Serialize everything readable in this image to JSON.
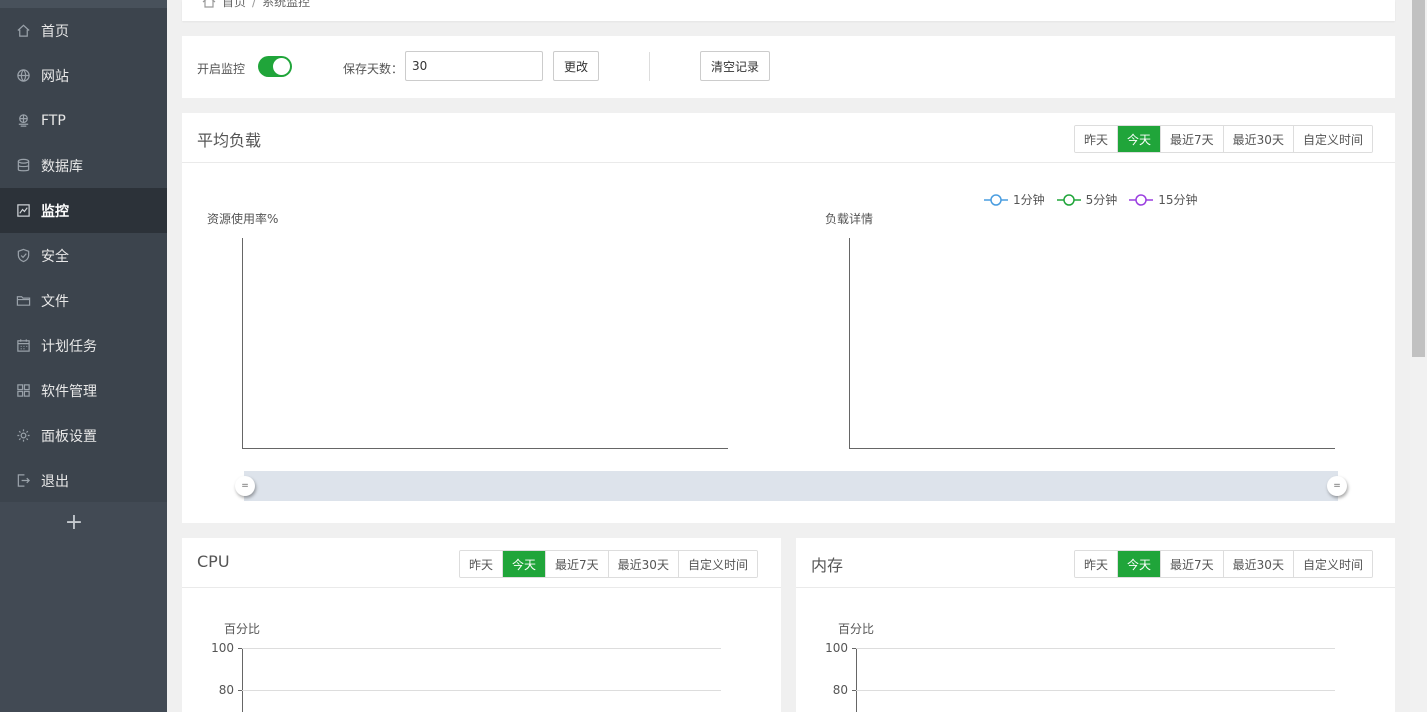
{
  "sidebar": {
    "items": [
      {
        "label": "首页",
        "icon": "home-icon",
        "active": false
      },
      {
        "label": "网站",
        "icon": "globe-icon",
        "active": false
      },
      {
        "label": "FTP",
        "icon": "ftp-icon",
        "active": false
      },
      {
        "label": "数据库",
        "icon": "database-icon",
        "active": false
      },
      {
        "label": "监控",
        "icon": "monitor-chart-icon",
        "active": true
      },
      {
        "label": "安全",
        "icon": "shield-icon",
        "active": false
      },
      {
        "label": "文件",
        "icon": "folder-icon",
        "active": false
      },
      {
        "label": "计划任务",
        "icon": "calendar-icon",
        "active": false
      },
      {
        "label": "软件管理",
        "icon": "grid-apps-icon",
        "active": false
      },
      {
        "label": "面板设置",
        "icon": "gear-icon",
        "active": false
      },
      {
        "label": "退出",
        "icon": "logout-icon",
        "active": false
      }
    ],
    "add_label": "+"
  },
  "breadcrumb": {
    "home": "首页",
    "sep": "/",
    "current": "系统监控"
  },
  "controls": {
    "monitor_label": "开启监控",
    "monitor_enabled": true,
    "days_label": "保存天数：",
    "days_value": "30",
    "change_label": "更改",
    "clear_label": "清空记录"
  },
  "range_options": [
    "昨天",
    "今天",
    "最近7天",
    "最近30天",
    "自定义时间"
  ],
  "range_selected": "今天",
  "load": {
    "title": "平均负载",
    "left_axis_name": "资源使用率%",
    "right_axis_name": "负载详情",
    "legend": [
      {
        "name": "1分钟",
        "color": "#4a9de0"
      },
      {
        "name": "5分钟",
        "color": "#20a53a"
      },
      {
        "name": "15分钟",
        "color": "#9b3fe0"
      }
    ],
    "zoom_handle_glyph": "="
  },
  "cpu": {
    "title": "CPU",
    "axis_name": "百分比",
    "yticks": [
      "100",
      "80"
    ]
  },
  "memory": {
    "title": "内存",
    "axis_name": "百分比",
    "yticks": [
      "100",
      "80"
    ]
  },
  "colors": {
    "accent": "#20a53a",
    "sidebar_bg": "#3c444d",
    "sidebar_active": "#2c3239"
  }
}
